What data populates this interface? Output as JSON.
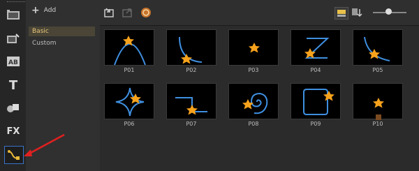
{
  "toolbar": {
    "add_label": "Add"
  },
  "categories": [
    {
      "label": "Basic",
      "selected": true
    },
    {
      "label": "Custom",
      "selected": false
    }
  ],
  "sidebar": {
    "items": [
      {
        "icon": "media-icon"
      },
      {
        "icon": "instant-project-icon"
      },
      {
        "icon": "transition-icon",
        "label": "AB"
      },
      {
        "icon": "title-icon",
        "label": "T"
      },
      {
        "icon": "graphic-icon"
      },
      {
        "icon": "filter-icon",
        "label": "FX"
      },
      {
        "icon": "path-icon",
        "active": true
      }
    ]
  },
  "paths": [
    {
      "label": "P01"
    },
    {
      "label": "P02"
    },
    {
      "label": "P03"
    },
    {
      "label": "P04"
    },
    {
      "label": "P05"
    },
    {
      "label": "P06"
    },
    {
      "label": "P07"
    },
    {
      "label": "P08"
    },
    {
      "label": "P09"
    },
    {
      "label": "P10"
    }
  ],
  "colors": {
    "accent": "#3a72c8",
    "path_line": "#3f8fe0",
    "star": "#f7a21c",
    "selected_bg": "#4a4536",
    "selected_text": "#e8c77a"
  }
}
